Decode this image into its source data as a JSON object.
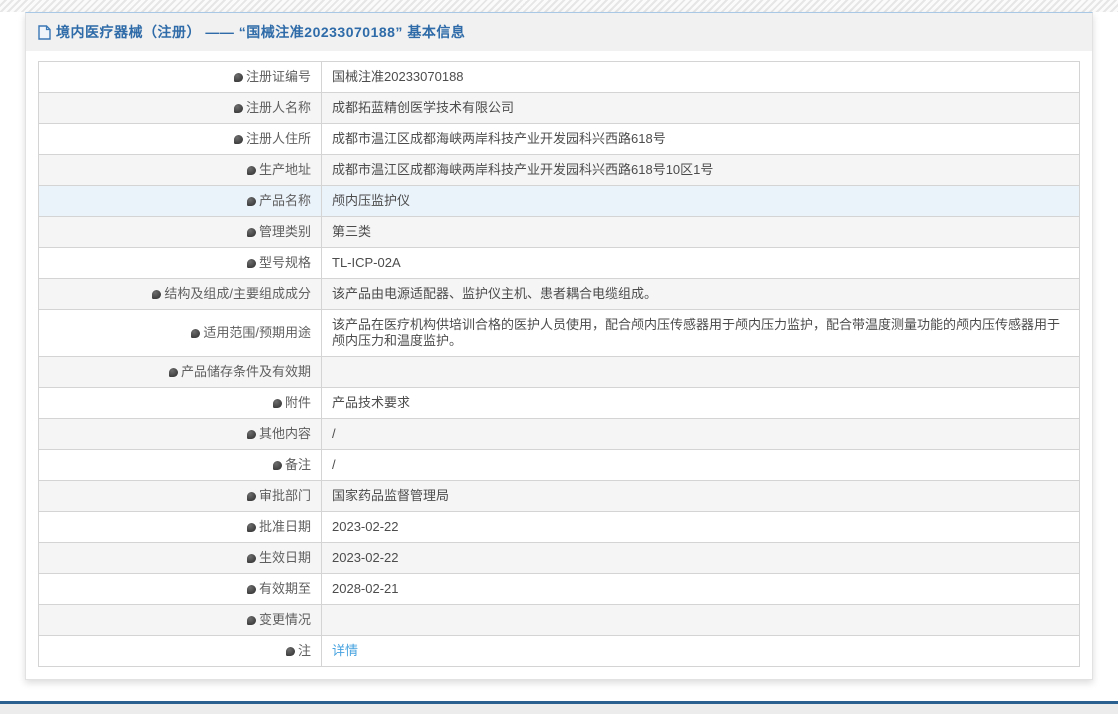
{
  "header": {
    "icon": "document-icon",
    "title": "境内医疗器械（注册） —— “国械注准20233070188” 基本信息"
  },
  "table": {
    "rows": [
      {
        "label": "注册证编号",
        "value": "国械注准20233070188"
      },
      {
        "label": "注册人名称",
        "value": "成都拓蓝精创医学技术有限公司"
      },
      {
        "label": "注册人住所",
        "value": "成都市温江区成都海峡两岸科技产业开发园科兴西路618号"
      },
      {
        "label": "生产地址",
        "value": "成都市温江区成都海峡两岸科技产业开发园科兴西路618号10区1号"
      },
      {
        "label": "产品名称",
        "value": "颅内压监护仪",
        "highlighted": true
      },
      {
        "label": "管理类别",
        "value": "第三类"
      },
      {
        "label": "型号规格",
        "value": "TL-ICP-02A"
      },
      {
        "label": "结构及组成/主要组成成分",
        "value": "该产品由电源适配器、监护仪主机、患者耦合电缆组成。"
      },
      {
        "label": "适用范围/预期用途",
        "value": "该产品在医疗机构供培训合格的医护人员使用，配合颅内压传感器用于颅内压力监护，配合带温度测量功能的颅内压传感器用于颅内压力和温度监护。"
      },
      {
        "label": "产品储存条件及有效期",
        "value": ""
      },
      {
        "label": "附件",
        "value": "产品技术要求"
      },
      {
        "label": "其他内容",
        "value": "/"
      },
      {
        "label": "备注",
        "value": "/"
      },
      {
        "label": "审批部门",
        "value": "国家药品监督管理局"
      },
      {
        "label": "批准日期",
        "value": "2023-02-22"
      },
      {
        "label": "生效日期",
        "value": "2023-02-22"
      },
      {
        "label": "有效期至",
        "value": "2028-02-21"
      },
      {
        "label": "变更情况",
        "value": ""
      },
      {
        "label": "注",
        "value": "详情",
        "value_type": "link",
        "label_icon": "balloon-icon"
      }
    ]
  },
  "colors": {
    "title_blue": "#2e6ba8",
    "link_blue": "#47a3e0",
    "footer_bar_blue": "#2a6090",
    "alt_row_gray": "#f5f5f5",
    "highlight_row_blue": "#eaf2fa"
  }
}
